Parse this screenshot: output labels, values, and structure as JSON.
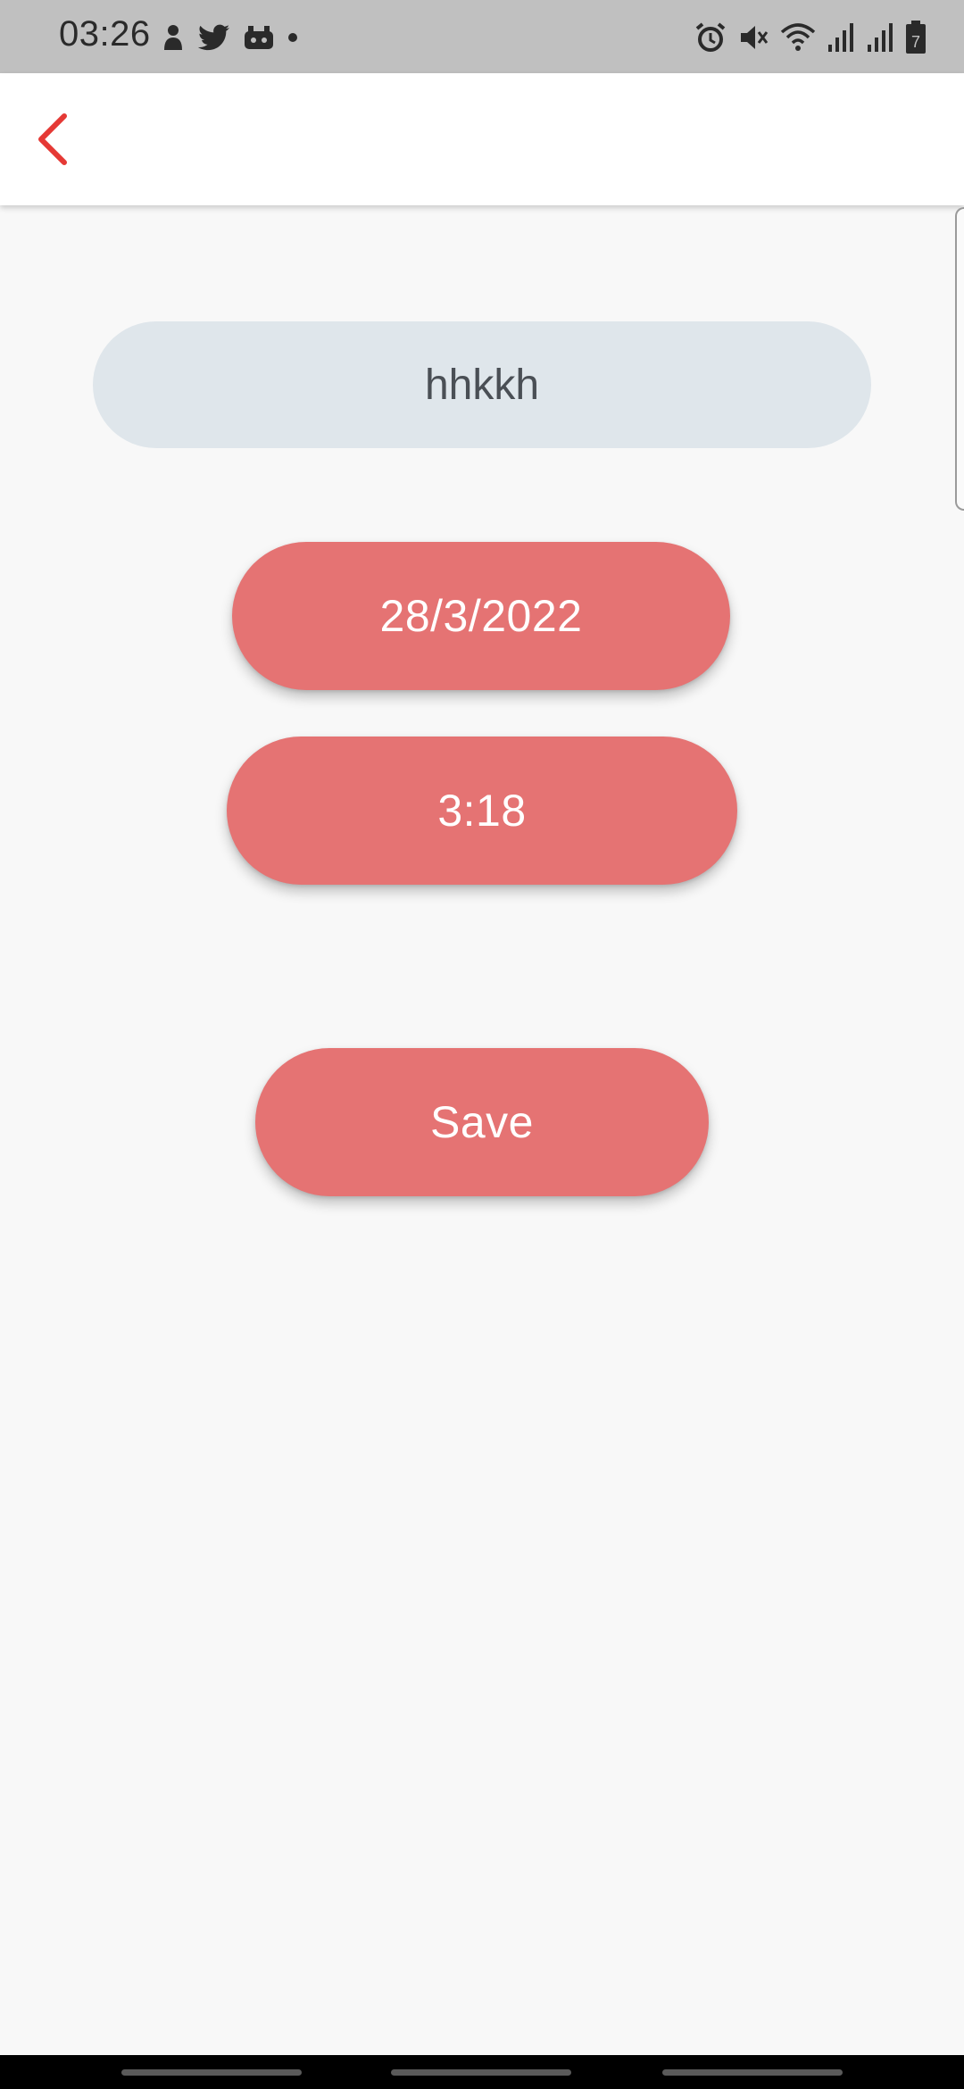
{
  "status_bar": {
    "time": "03:26",
    "left_icons": [
      "notification-character-icon",
      "twitter-icon",
      "game-icon",
      "dot-icon"
    ],
    "right_icons": [
      "alarm-icon",
      "mute-icon",
      "wifi-icon",
      "signal-icon",
      "signal-icon",
      "battery-icon"
    ],
    "battery_level": "7"
  },
  "app_bar": {
    "back_icon": "chevron-left-icon",
    "accent_color": "#e53935"
  },
  "form": {
    "title_value": "hhkkh",
    "date_label": "28/3/2022",
    "time_label": "3:18",
    "save_label": "Save"
  },
  "colors": {
    "button": "#e57373",
    "field": "#dfe6eb",
    "background": "#f8f8f8"
  }
}
